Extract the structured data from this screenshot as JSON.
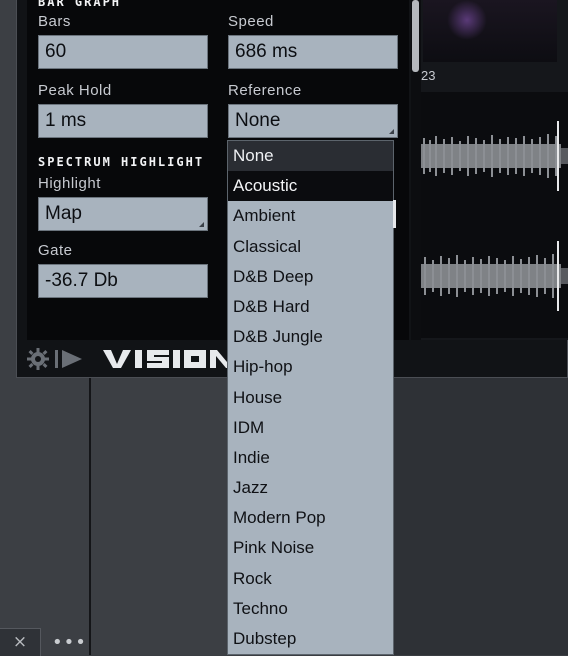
{
  "bar_graph": {
    "section_title": "BAR GRAPH",
    "bars_label": "Bars",
    "bars_value": "60",
    "speed_label": "Speed",
    "speed_value": "686 ms",
    "peak_hold_label": "Peak Hold",
    "peak_hold_value": "1 ms",
    "reference_label": "Reference",
    "reference_value": "None"
  },
  "spectrum_highlight": {
    "section_title": "SPECTRUM HIGHLIGHT",
    "highlight_label": "Highlight",
    "highlight_value": "Map",
    "gate_label": "Gate",
    "gate_value": "-36.7 Db"
  },
  "toolbar": {
    "logo_text": "VISION",
    "gear_icon": "gear-icon",
    "play_icon": "play-icon"
  },
  "waveform": {
    "track_number": "23"
  },
  "reference_dropdown": {
    "options": [
      "None",
      "Acoustic",
      "Ambient",
      "Classical",
      "D&B Deep",
      "D&B Hard",
      "D&B Jungle",
      "Hip-hop",
      "House",
      "IDM",
      "Indie",
      "Jazz",
      "Modern Pop",
      "Pink Noise",
      "Rock",
      "Techno",
      "Dubstep"
    ],
    "selected": "None",
    "hovered": "Acoustic"
  },
  "host": {
    "close_glyph": "×",
    "more_glyph": "•••"
  },
  "colors": {
    "field_bg": "#a8b3be",
    "panel_bg": "#07080a",
    "host_bg": "#3c3f44"
  }
}
